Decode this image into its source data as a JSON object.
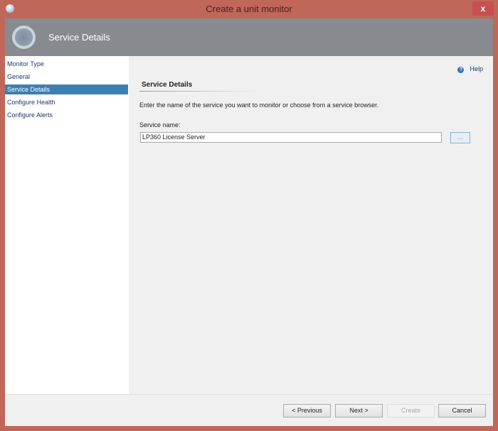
{
  "window": {
    "title": "Create a unit monitor",
    "close_label": "x"
  },
  "header": {
    "title": "Service Details"
  },
  "nav": {
    "items": [
      {
        "label": "Monitor Type"
      },
      {
        "label": "General"
      },
      {
        "label": "Service Details",
        "selected": true
      },
      {
        "label": "Configure Health"
      },
      {
        "label": "Configure Alerts"
      }
    ]
  },
  "content": {
    "help": "Help",
    "section_title": "Service Details",
    "description": "Enter the name of the service you want to monitor or choose from a service browser.",
    "service_label": "Service name:",
    "service_value": "LP360 License Server",
    "browse_label": "..."
  },
  "footer": {
    "previous": "< Previous",
    "next": "Next >",
    "create": "Create",
    "cancel": "Cancel"
  },
  "colors": {
    "border": "#c0675a",
    "header": "#878b90",
    "selected": "#3c7fb1"
  }
}
